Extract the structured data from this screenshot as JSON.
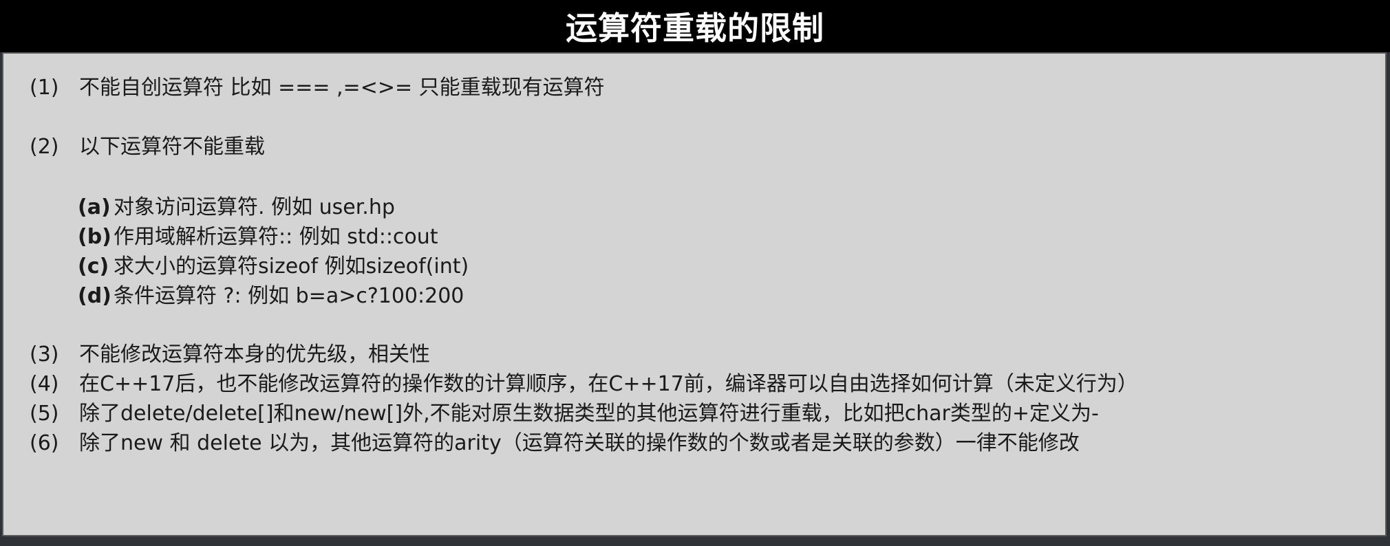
{
  "title": "运算符重载的限制",
  "colors": {
    "title_bar": "#000000",
    "panel": "#d4d4d4",
    "text": "#1a1a1a"
  },
  "items": [
    {
      "num": "(1)",
      "text": "不能自创运算符 比如 === ,=<>= 只能重载现有运算符"
    },
    {
      "num": "(2)",
      "text": "以下运算符不能重载"
    },
    {
      "num": "(3)",
      "text": "不能修改运算符本身的优先级，相关性"
    },
    {
      "num": "(4)",
      "text": "在C++17后，也不能修改运算符的操作数的计算顺序，在C++17前，编译器可以自由选择如何计算（未定义行为）"
    },
    {
      "num": "(5)",
      "text": "除了delete/delete[]和new/new[]外,不能对原生数据类型的其他运算符进行重载，比如把char类型的+定义为-"
    },
    {
      "num": "(6)",
      "text": "除了new 和 delete 以为，其他运算符的arity（运算符关联的操作数的个数或者是关联的参数）一律不能修改"
    }
  ],
  "subitems": [
    {
      "num": "(a)",
      "text": "对象访问运算符.  例如 user.hp"
    },
    {
      "num": "(b)",
      "text": "作用域解析运算符::  例如 std::cout"
    },
    {
      "num": "(c)",
      "text": "求大小的运算符sizeof 例如sizeof(int)"
    },
    {
      "num": "(d)",
      "text": "条件运算符 ?: 例如 b=a>c?100:200"
    }
  ]
}
